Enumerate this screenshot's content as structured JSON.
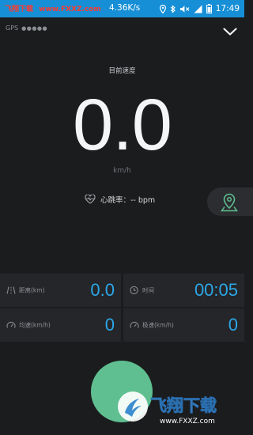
{
  "status_bar": {
    "brand": "飞翔下载",
    "site": "www.FXXZ.com",
    "net_speed": "4.36K/s",
    "time": "17:49"
  },
  "gps": {
    "label": "GPS",
    "signal": "●●●●●"
  },
  "speed": {
    "label": "目前速度",
    "value": "0.0",
    "unit": "km/h"
  },
  "heart_rate": {
    "label": "心跳率：-- bpm"
  },
  "stats": {
    "distance": {
      "label": "距离(km)",
      "value": "0.0"
    },
    "time": {
      "label": "时间",
      "value": "00:05"
    },
    "avg_speed": {
      "label": "均速(km/h)",
      "value": "0"
    },
    "max_speed": {
      "label": "极速(km/h)",
      "value": "0"
    }
  },
  "watermark": {
    "title": "飞翔下载",
    "site": "www.FXXZ.com"
  },
  "colors": {
    "status_bar": "#168fd6",
    "background": "#1b1c1e",
    "value_accent": "#2ba7e8",
    "start_button": "#5fbf90",
    "map_icon": "#5fbf90"
  }
}
